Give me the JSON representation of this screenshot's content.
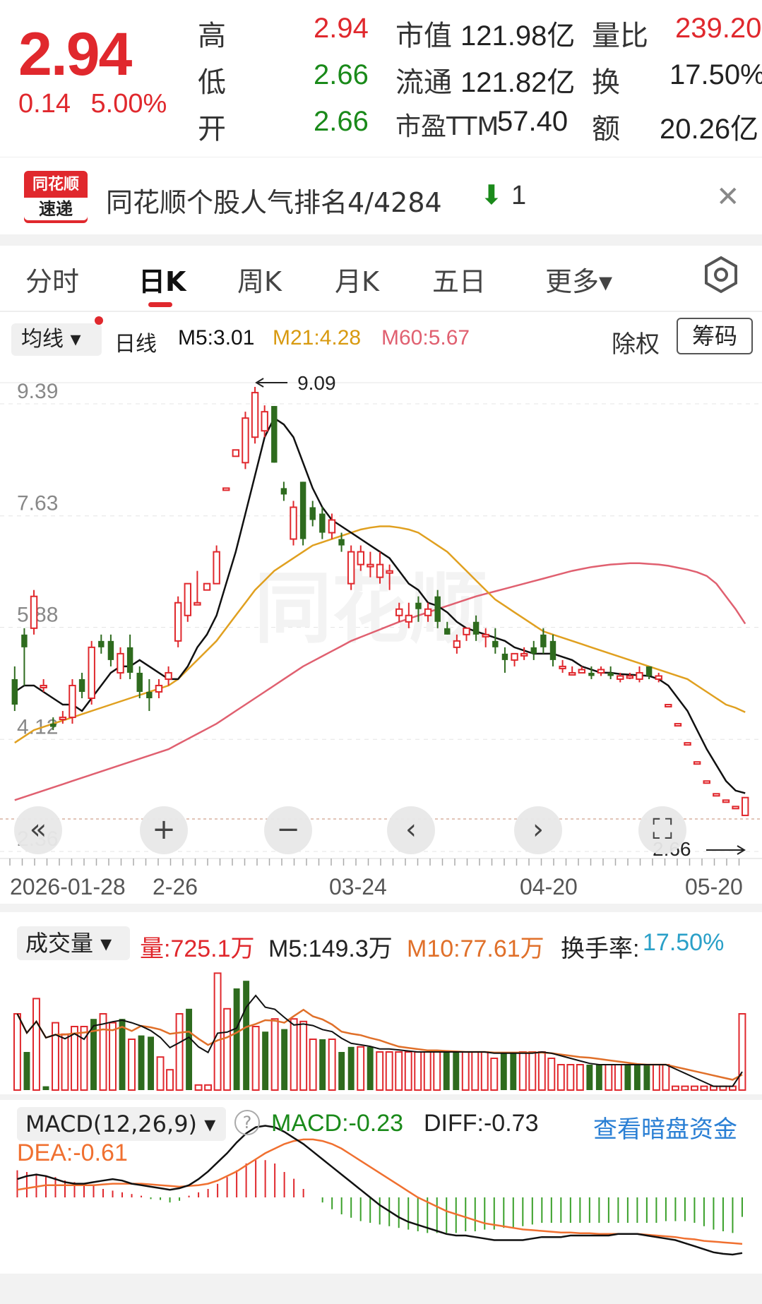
{
  "quote": {
    "price": "2.94",
    "change": "0.14",
    "change_pct": "5.00%",
    "high_label": "高",
    "high": "2.94",
    "low_label": "低",
    "low": "2.66",
    "open_label": "开",
    "open": "2.66",
    "mktcap_label": "市值",
    "mktcap": "121.98亿",
    "float_label": "流通",
    "float": "121.82亿",
    "pe_label": "市盈TTM",
    "pe": "57.40",
    "volratio_label": "量比",
    "volratio": "239.20",
    "turnover_label": "换",
    "turnover": "17.50%",
    "amount_label": "额",
    "amount": "20.26亿"
  },
  "banner": {
    "logo_top": "同花顺",
    "logo_bottom": "速递",
    "text": "同花顺个股人气排名4/4284",
    "rank_change": "1",
    "close_icon": "close-icon"
  },
  "tabs": [
    "分时",
    "日K",
    "周K",
    "月K",
    "五日",
    "更多▾"
  ],
  "indicators": {
    "ma_select": "均线 ▾",
    "period": "日线",
    "m5": "M5:3.01",
    "m21": "M21:4.28",
    "m60": "M60:5.67",
    "chuquan": "除权",
    "chouma": "筹码"
  },
  "colors": {
    "up": "#e0282d",
    "down": "#2e6b1e",
    "m5": "#111111",
    "m21": "#e0a020",
    "m60": "#e06070",
    "macd_dea": "#f07030",
    "link": "#2a7fd4"
  },
  "price_axis": [
    "9.39",
    "7.63",
    "5.88",
    "4.12",
    "2.36"
  ],
  "annotations": {
    "max": "9.09",
    "min": "2.66"
  },
  "watermark": "同花顺",
  "date_axis": [
    "2026-01-28",
    "2-26",
    "03-24",
    "04-20",
    "05-20"
  ],
  "controls": [
    "«",
    "+",
    "−",
    "‹",
    "›",
    "⛶"
  ],
  "volume": {
    "select": "成交量 ▾",
    "vol": "量:725.1万",
    "m5": "M5:149.3万",
    "m10": "M10:77.61万",
    "turnover_label": "换手率:",
    "turnover": "17.50%"
  },
  "macd": {
    "select": "MACD(12,26,9) ▾",
    "macd": "MACD:-0.23",
    "diff": "DIFF:-0.73",
    "dea": "DEA:-0.61",
    "link": "查看暗盘资金"
  },
  "chart_data": {
    "type": "candlestick",
    "ylim": [
      2.36,
      9.39
    ],
    "candles": [
      [
        4.8,
        4.4,
        5.0,
        4.3
      ],
      [
        5.5,
        5.3,
        5.6,
        4.7
      ],
      [
        5.6,
        6.1,
        6.2,
        5.5
      ],
      [
        4.7,
        4.7,
        4.8,
        4.6
      ],
      [
        4.1,
        4.05,
        4.2,
        4.0
      ],
      [
        4.2,
        4.2,
        4.3,
        4.1
      ],
      [
        4.2,
        4.7,
        4.8,
        4.1
      ],
      [
        4.8,
        4.6,
        4.9,
        4.5
      ],
      [
        4.5,
        5.3,
        5.4,
        4.4
      ],
      [
        5.4,
        5.3,
        5.5,
        5.2
      ],
      [
        5.4,
        5.1,
        5.5,
        5.0
      ],
      [
        4.9,
        5.2,
        5.3,
        4.8
      ],
      [
        5.3,
        4.9,
        5.5,
        4.8
      ],
      [
        4.9,
        4.6,
        5.0,
        4.5
      ],
      [
        4.6,
        4.5,
        4.8,
        4.3
      ],
      [
        4.6,
        4.7,
        4.8,
        4.5
      ],
      [
        4.8,
        4.9,
        5.0,
        4.7
      ],
      [
        5.4,
        6.0,
        6.1,
        5.3
      ],
      [
        5.8,
        6.3,
        6.3,
        5.7
      ],
      [
        6.0,
        6.0,
        6.5,
        6.0
      ],
      [
        6.2,
        6.3,
        6.3,
        6.2
      ],
      [
        6.3,
        6.8,
        6.9,
        6.3
      ],
      [
        7.8,
        7.8,
        7.8,
        7.8
      ],
      [
        8.3,
        8.4,
        8.4,
        8.3
      ],
      [
        8.2,
        8.9,
        9.0,
        8.1
      ],
      [
        8.6,
        9.3,
        9.39,
        8.5
      ],
      [
        8.7,
        9.0,
        9.1,
        8.6
      ],
      [
        9.09,
        8.2,
        9.09,
        8.2
      ],
      [
        7.8,
        7.7,
        7.9,
        7.6
      ],
      [
        7.0,
        7.5,
        7.6,
        6.9
      ],
      [
        7.9,
        7.0,
        7.9,
        6.9
      ],
      [
        7.5,
        7.3,
        7.6,
        7.2
      ],
      [
        7.4,
        7.1,
        7.5,
        7.0
      ],
      [
        7.1,
        7.3,
        7.4,
        7.0
      ],
      [
        7.0,
        6.9,
        7.1,
        6.8
      ],
      [
        6.3,
        6.8,
        6.9,
        6.2
      ],
      [
        6.6,
        6.8,
        6.9,
        6.5
      ],
      [
        6.6,
        6.6,
        6.8,
        6.4
      ],
      [
        6.4,
        6.6,
        6.8,
        6.3
      ],
      [
        6.5,
        6.5,
        6.6,
        6.2
      ],
      [
        5.8,
        5.9,
        6.0,
        5.7
      ],
      [
        5.7,
        5.8,
        6.0,
        5.6
      ],
      [
        6.0,
        5.9,
        6.1,
        5.7
      ],
      [
        5.8,
        5.9,
        6.0,
        5.7
      ],
      [
        6.1,
        5.7,
        6.2,
        5.6
      ],
      [
        5.6,
        5.5,
        5.7,
        5.5
      ],
      [
        5.3,
        5.4,
        5.5,
        5.2
      ],
      [
        5.5,
        5.6,
        5.6,
        5.4
      ],
      [
        5.7,
        5.5,
        5.8,
        5.4
      ],
      [
        5.5,
        5.5,
        5.6,
        5.3
      ],
      [
        5.4,
        5.3,
        5.6,
        5.2
      ],
      [
        5.2,
        5.1,
        5.3,
        4.9
      ],
      [
        5.1,
        5.2,
        5.2,
        5.0
      ],
      [
        5.2,
        5.2,
        5.3,
        5.1
      ],
      [
        5.3,
        5.2,
        5.4,
        5.1
      ],
      [
        5.5,
        5.3,
        5.6,
        5.2
      ],
      [
        5.4,
        5.1,
        5.5,
        5.0
      ],
      [
        5.0,
        5.0,
        5.1,
        4.9
      ],
      [
        4.9,
        4.9,
        5.0,
        4.9
      ],
      [
        4.9,
        4.95,
        5.0,
        4.9
      ],
      [
        4.9,
        4.85,
        5.0,
        4.8
      ],
      [
        4.9,
        4.95,
        5.0,
        4.85
      ],
      [
        4.9,
        4.85,
        5.0,
        4.8
      ],
      [
        4.8,
        4.85,
        4.9,
        4.75
      ],
      [
        4.85,
        4.85,
        4.9,
        4.8
      ],
      [
        4.8,
        4.9,
        5.0,
        4.75
      ],
      [
        5.0,
        4.85,
        5.0,
        4.8
      ],
      [
        4.8,
        4.85,
        4.9,
        4.75
      ],
      [
        4.4,
        4.4,
        4.4,
        4.4
      ],
      [
        4.1,
        4.1,
        4.1,
        4.1
      ],
      [
        3.8,
        3.8,
        3.8,
        3.8
      ],
      [
        3.5,
        3.5,
        3.5,
        3.5
      ],
      [
        3.2,
        3.2,
        3.2,
        3.2
      ],
      [
        3.0,
        3.0,
        3.0,
        3.0
      ],
      [
        2.9,
        2.9,
        2.9,
        2.9
      ],
      [
        2.8,
        2.8,
        2.8,
        2.8
      ],
      [
        2.66,
        2.94,
        2.94,
        2.66
      ]
    ],
    "ma5": [
      4.6,
      4.7,
      4.7,
      4.6,
      4.5,
      4.4,
      4.4,
      4.3,
      4.5,
      4.7,
      4.9,
      5.0,
      5.0,
      5.1,
      5.0,
      4.9,
      4.8,
      4.8,
      5.0,
      5.3,
      5.5,
      5.8,
      6.3,
      6.8,
      7.4,
      8.0,
      8.6,
      8.9,
      8.8,
      8.6,
      8.2,
      7.8,
      7.5,
      7.3,
      7.2,
      7.1,
      7.0,
      6.9,
      6.8,
      6.7,
      6.5,
      6.3,
      6.2,
      6.0,
      5.95,
      5.85,
      5.7,
      5.6,
      5.55,
      5.5,
      5.45,
      5.4,
      5.3,
      5.25,
      5.2,
      5.2,
      5.2,
      5.15,
      5.1,
      5.0,
      4.95,
      4.9,
      4.9,
      4.88,
      4.87,
      4.86,
      4.85,
      4.8,
      4.7,
      4.5,
      4.3,
      4.0,
      3.7,
      3.45,
      3.2,
      3.05,
      3.01
    ],
    "ma21": [
      3.8,
      3.9,
      4.0,
      4.05,
      4.1,
      4.15,
      4.2,
      4.25,
      4.3,
      4.35,
      4.4,
      4.45,
      4.5,
      4.55,
      4.6,
      4.65,
      4.7,
      4.8,
      4.95,
      5.1,
      5.25,
      5.4,
      5.6,
      5.8,
      6.0,
      6.2,
      6.35,
      6.5,
      6.6,
      6.7,
      6.8,
      6.9,
      6.95,
      7.0,
      7.05,
      7.1,
      7.15,
      7.18,
      7.2,
      7.2,
      7.18,
      7.15,
      7.1,
      7.0,
      6.9,
      6.8,
      6.65,
      6.5,
      6.35,
      6.2,
      6.05,
      5.95,
      5.85,
      5.75,
      5.65,
      5.55,
      5.5,
      5.45,
      5.4,
      5.35,
      5.3,
      5.25,
      5.2,
      5.15,
      5.1,
      5.05,
      5.0,
      4.95,
      4.9,
      4.85,
      4.8,
      4.7,
      4.6,
      4.5,
      4.4,
      4.35,
      4.28
    ],
    "ma60": [
      2.9,
      2.95,
      3.0,
      3.05,
      3.1,
      3.15,
      3.2,
      3.25,
      3.3,
      3.35,
      3.4,
      3.45,
      3.5,
      3.55,
      3.6,
      3.65,
      3.7,
      3.78,
      3.86,
      3.94,
      4.02,
      4.1,
      4.2,
      4.3,
      4.4,
      4.5,
      4.6,
      4.7,
      4.8,
      4.9,
      5.0,
      5.08,
      5.16,
      5.24,
      5.32,
      5.4,
      5.46,
      5.52,
      5.58,
      5.64,
      5.7,
      5.75,
      5.8,
      5.85,
      5.9,
      5.95,
      6.0,
      6.05,
      6.1,
      6.14,
      6.18,
      6.22,
      6.26,
      6.3,
      6.34,
      6.38,
      6.42,
      6.46,
      6.5,
      6.53,
      6.56,
      6.58,
      6.6,
      6.61,
      6.62,
      6.62,
      6.61,
      6.6,
      6.58,
      6.55,
      6.52,
      6.48,
      6.42,
      6.3,
      6.1,
      5.9,
      5.67
    ],
    "volume": [
      0.6,
      0.3,
      0.72,
      0.03,
      0.53,
      0.44,
      0.5,
      0.5,
      0.56,
      0.6,
      0.53,
      0.56,
      0.4,
      0.43,
      0.42,
      0.26,
      0.16,
      0.6,
      0.64,
      0.04,
      0.04,
      0.92,
      0.64,
      0.8,
      0.86,
      0.5,
      0.46,
      0.56,
      0.48,
      0.56,
      0.54,
      0.4,
      0.4,
      0.4,
      0.3,
      0.34,
      0.34,
      0.34,
      0.3,
      0.3,
      0.3,
      0.3,
      0.3,
      0.3,
      0.3,
      0.3,
      0.3,
      0.3,
      0.3,
      0.3,
      0.25,
      0.3,
      0.3,
      0.3,
      0.3,
      0.3,
      0.25,
      0.2,
      0.2,
      0.2,
      0.2,
      0.2,
      0.2,
      0.2,
      0.2,
      0.2,
      0.2,
      0.2,
      0.2,
      0.03,
      0.03,
      0.03,
      0.03,
      0.03,
      0.03,
      0.03,
      0.6
    ],
    "volume_up": [
      1,
      0,
      1,
      0,
      1,
      1,
      1,
      1,
      0,
      1,
      1,
      0,
      1,
      0,
      0,
      1,
      1,
      1,
      0,
      1,
      1,
      1,
      1,
      0,
      0,
      1,
      0,
      1,
      0,
      1,
      1,
      1,
      0,
      1,
      0,
      0,
      1,
      0,
      1,
      1,
      1,
      1,
      1,
      1,
      1,
      0,
      0,
      1,
      1,
      1,
      1,
      0,
      0,
      1,
      1,
      1,
      1,
      1,
      1,
      1,
      0,
      0,
      1,
      1,
      0,
      0,
      0,
      1,
      1,
      1,
      1,
      1,
      1,
      1,
      1,
      1,
      1
    ],
    "macd_hist": [
      0.32,
      0.3,
      0.28,
      0.26,
      0.24,
      0.2,
      0.18,
      0.16,
      0.14,
      0.1,
      0.08,
      0.06,
      0.04,
      0.02,
      -0.02,
      -0.03,
      -0.06,
      -0.04,
      0.02,
      0.06,
      0.1,
      0.16,
      0.24,
      0.32,
      0.4,
      0.44,
      0.44,
      0.4,
      0.3,
      0.22,
      0.1,
      0.0,
      -0.06,
      -0.14,
      -0.2,
      -0.24,
      -0.28,
      -0.3,
      -0.32,
      -0.34,
      -0.36,
      -0.38,
      -0.4,
      -0.42,
      -0.42,
      -0.42,
      -0.42,
      -0.4,
      -0.4,
      -0.38,
      -0.38,
      -0.36,
      -0.36,
      -0.34,
      -0.32,
      -0.3,
      -0.3,
      -0.3,
      -0.3,
      -0.3,
      -0.3,
      -0.3,
      -0.3,
      -0.3,
      -0.3,
      -0.3,
      -0.3,
      -0.3,
      -0.28,
      -0.28,
      -0.28,
      -0.3,
      -0.34,
      -0.38,
      -0.4,
      -0.42,
      -0.23
    ],
    "macd_diff": [
      0.24,
      0.28,
      0.3,
      0.28,
      0.24,
      0.2,
      0.18,
      0.18,
      0.2,
      0.22,
      0.24,
      0.22,
      0.18,
      0.16,
      0.14,
      0.12,
      0.1,
      0.12,
      0.16,
      0.24,
      0.34,
      0.46,
      0.58,
      0.72,
      0.84,
      0.92,
      0.94,
      0.92,
      0.86,
      0.78,
      0.7,
      0.6,
      0.5,
      0.4,
      0.3,
      0.2,
      0.1,
      0.0,
      -0.1,
      -0.18,
      -0.26,
      -0.32,
      -0.36,
      -0.4,
      -0.44,
      -0.48,
      -0.5,
      -0.5,
      -0.52,
      -0.54,
      -0.56,
      -0.56,
      -0.56,
      -0.56,
      -0.54,
      -0.52,
      -0.52,
      -0.52,
      -0.5,
      -0.5,
      -0.5,
      -0.5,
      -0.5,
      -0.48,
      -0.48,
      -0.48,
      -0.5,
      -0.52,
      -0.54,
      -0.56,
      -0.6,
      -0.64,
      -0.68,
      -0.72,
      -0.74,
      -0.75,
      -0.73
    ],
    "macd_dea": [
      0.1,
      0.12,
      0.14,
      0.16,
      0.16,
      0.16,
      0.16,
      0.16,
      0.16,
      0.17,
      0.18,
      0.18,
      0.18,
      0.18,
      0.17,
      0.16,
      0.15,
      0.14,
      0.15,
      0.16,
      0.18,
      0.22,
      0.28,
      0.34,
      0.42,
      0.5,
      0.58,
      0.64,
      0.7,
      0.74,
      0.76,
      0.76,
      0.74,
      0.7,
      0.64,
      0.56,
      0.48,
      0.4,
      0.32,
      0.24,
      0.16,
      0.08,
      0.0,
      -0.06,
      -0.12,
      -0.18,
      -0.22,
      -0.26,
      -0.3,
      -0.34,
      -0.36,
      -0.38,
      -0.4,
      -0.42,
      -0.43,
      -0.44,
      -0.45,
      -0.46,
      -0.46,
      -0.47,
      -0.47,
      -0.48,
      -0.48,
      -0.48,
      -0.48,
      -0.48,
      -0.49,
      -0.5,
      -0.51,
      -0.52,
      -0.54,
      -0.55,
      -0.57,
      -0.58,
      -0.59,
      -0.6,
      -0.61
    ]
  }
}
